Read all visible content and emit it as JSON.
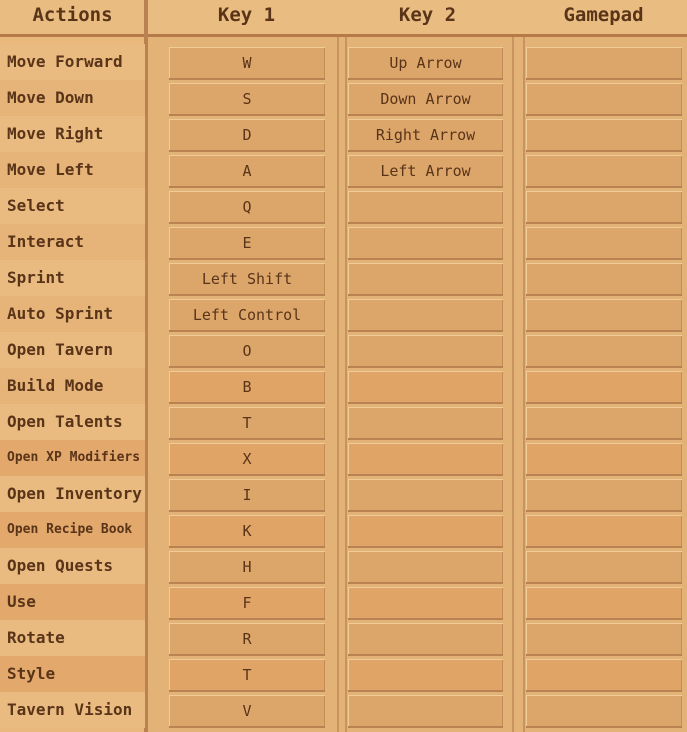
{
  "headers": {
    "actions": "Actions",
    "key1": "Key 1",
    "key2": "Key 2",
    "gamepad": "Gamepad"
  },
  "rows": [
    {
      "action": "Move Forward",
      "key1": "W",
      "key2": "Up Arrow",
      "gamepad": ""
    },
    {
      "action": "Move Down",
      "key1": "S",
      "key2": "Down Arrow",
      "gamepad": ""
    },
    {
      "action": "Move Right",
      "key1": "D",
      "key2": "Right Arrow",
      "gamepad": ""
    },
    {
      "action": "Move Left",
      "key1": "A",
      "key2": "Left Arrow",
      "gamepad": ""
    },
    {
      "action": "Select",
      "key1": "Q",
      "key2": "",
      "gamepad": ""
    },
    {
      "action": "Interact",
      "key1": "E",
      "key2": "",
      "gamepad": ""
    },
    {
      "action": "Sprint",
      "key1": "Left Shift",
      "key2": "",
      "gamepad": ""
    },
    {
      "action": "Auto Sprint",
      "key1": "Left Control",
      "key2": "",
      "gamepad": ""
    },
    {
      "action": "Open Tavern",
      "key1": "O",
      "key2": "",
      "gamepad": ""
    },
    {
      "action": "Build Mode",
      "key1": "B",
      "key2": "",
      "gamepad": ""
    },
    {
      "action": "Open Talents",
      "key1": "T",
      "key2": "",
      "gamepad": ""
    },
    {
      "action": "Open XP Modifiers",
      "key1": "X",
      "key2": "",
      "gamepad": ""
    },
    {
      "action": "Open Inventory",
      "key1": "I",
      "key2": "",
      "gamepad": ""
    },
    {
      "action": "Open Recipe Book",
      "key1": "K",
      "key2": "",
      "gamepad": ""
    },
    {
      "action": "Open Quests",
      "key1": "H",
      "key2": "",
      "gamepad": ""
    },
    {
      "action": "Use",
      "key1": "F",
      "key2": "",
      "gamepad": ""
    },
    {
      "action": "Rotate",
      "key1": "R",
      "key2": "",
      "gamepad": ""
    },
    {
      "action": "Style",
      "key1": "T",
      "key2": "",
      "gamepad": ""
    },
    {
      "action": "Tavern Vision",
      "key1": "V",
      "key2": "",
      "gamepad": ""
    }
  ]
}
